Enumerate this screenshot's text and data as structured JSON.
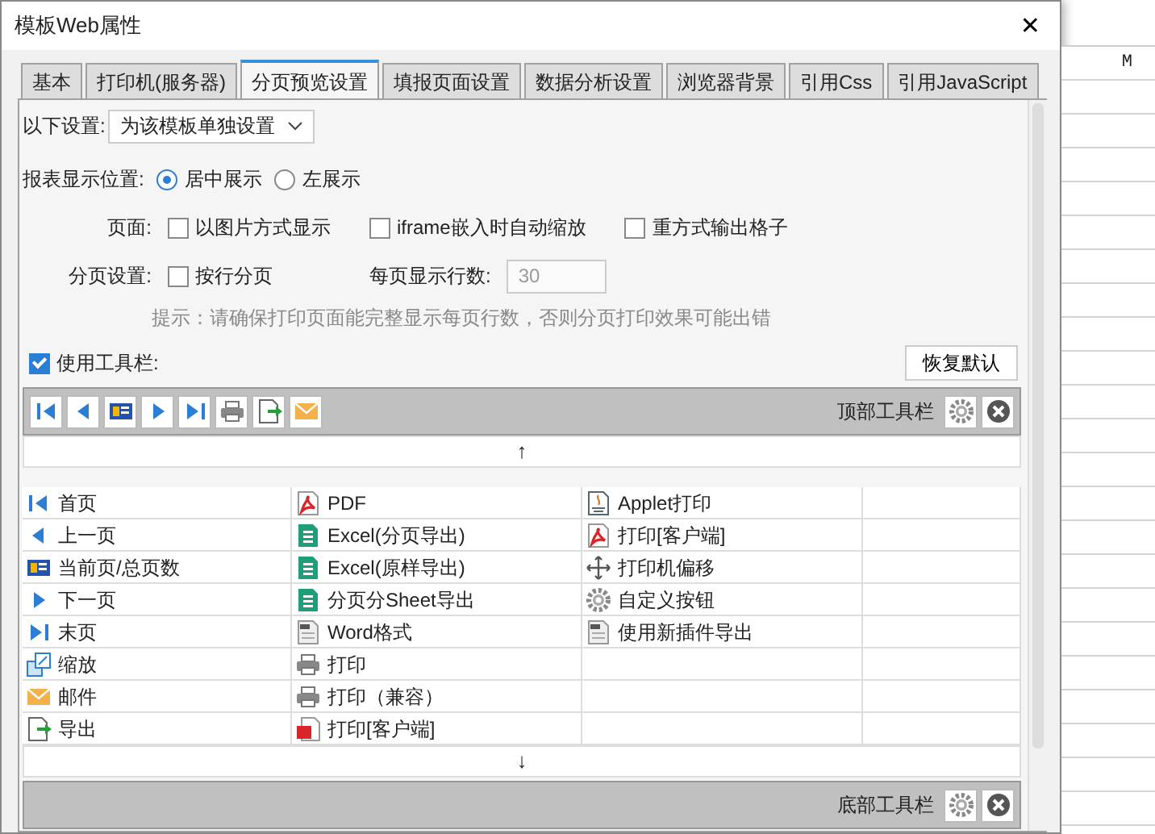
{
  "window": {
    "title": "模板Web属性",
    "close": "✕"
  },
  "tabs": [
    {
      "label": "基本",
      "selected": false
    },
    {
      "label": "打印机(服务器)",
      "selected": false
    },
    {
      "label": "分页预览设置",
      "selected": true
    },
    {
      "label": "填报页面设置",
      "selected": false
    },
    {
      "label": "数据分析设置",
      "selected": false
    },
    {
      "label": "浏览器背景",
      "selected": false
    },
    {
      "label": "引用Css",
      "selected": false
    },
    {
      "label": "引用JavaScript",
      "selected": false
    }
  ],
  "scope": {
    "label": "以下设置:",
    "value": "为该模板单独设置"
  },
  "position": {
    "label": "报表显示位置:",
    "options": [
      {
        "label": "居中展示",
        "selected": true
      },
      {
        "label": "左展示",
        "selected": false
      }
    ]
  },
  "page": {
    "label": "页面:",
    "options": [
      {
        "label": "以图片方式显示",
        "checked": false
      },
      {
        "label": "iframe嵌入时自动缩放",
        "checked": false
      },
      {
        "label": "重方式输出格子",
        "checked": false
      }
    ]
  },
  "pagination": {
    "label": "分页设置:",
    "option": {
      "label": "按行分页",
      "checked": false
    },
    "rows_label": "每页显示行数:",
    "rows_value": "30",
    "rows_disabled": true
  },
  "hint": "提示：请确保打印页面能完整显示每页行数，否则分页打印效果可能出错",
  "use_toolbar": {
    "label": "使用工具栏:",
    "checked": true
  },
  "restore_button": "恢复默认",
  "top_toolbar": {
    "buttons": [
      {
        "kind": "first"
      },
      {
        "kind": "prev"
      },
      {
        "kind": "page"
      },
      {
        "kind": "next"
      },
      {
        "kind": "last"
      },
      {
        "kind": "print"
      },
      {
        "kind": "export"
      },
      {
        "kind": "mail"
      }
    ],
    "label": "顶部工具栏"
  },
  "up_arrow": "↑",
  "grid": [
    [
      {
        "kind": "first",
        "label": "首页"
      },
      {
        "kind": "pdf",
        "label": "PDF"
      },
      {
        "kind": "applet",
        "label": "Applet打印"
      }
    ],
    [
      {
        "kind": "prev",
        "label": "上一页"
      },
      {
        "kind": "excel",
        "label": "Excel(分页导出)"
      },
      {
        "kind": "pdf",
        "label": "打印[客户端]"
      }
    ],
    [
      {
        "kind": "page",
        "label": "当前页/总页数"
      },
      {
        "kind": "excel",
        "label": "Excel(原样导出)"
      },
      {
        "kind": "move",
        "label": "打印机偏移"
      }
    ],
    [
      {
        "kind": "next",
        "label": "下一页"
      },
      {
        "kind": "excel",
        "label": "分页分Sheet导出"
      },
      {
        "kind": "gear",
        "label": "自定义按钮"
      }
    ],
    [
      {
        "kind": "last",
        "label": "末页"
      },
      {
        "kind": "word",
        "label": "Word格式"
      },
      {
        "kind": "word",
        "label": "使用新插件导出"
      }
    ],
    [
      {
        "kind": "zoom",
        "label": "缩放"
      },
      {
        "kind": "print",
        "label": "打印"
      }
    ],
    [
      {
        "kind": "mail",
        "label": "邮件"
      },
      {
        "kind": "print",
        "label": "打印（兼容）"
      }
    ],
    [
      {
        "kind": "export",
        "label": "导出"
      },
      {
        "kind": "flash",
        "label": "打印[客户端]"
      }
    ]
  ],
  "down_arrow": "↓",
  "bottom_toolbar": {
    "label": "底部工具栏"
  },
  "sheet": {
    "column_header": "M"
  }
}
